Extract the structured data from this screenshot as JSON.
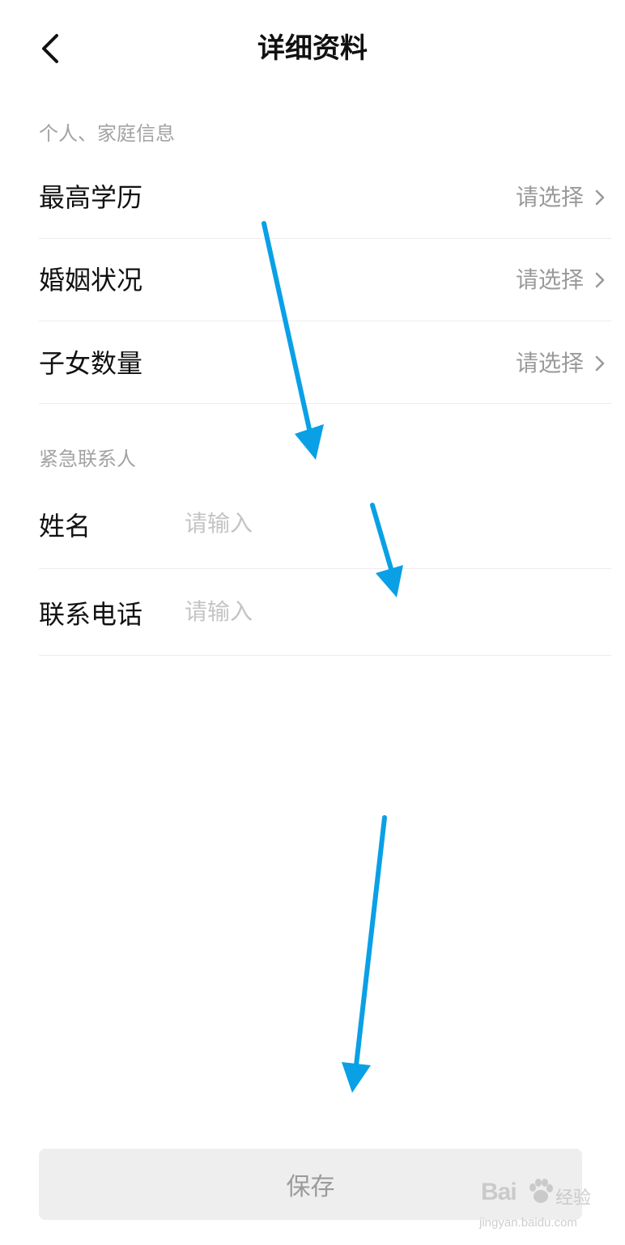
{
  "header": {
    "title": "详细资料",
    "back_icon": "chevron-left-icon"
  },
  "sections": [
    {
      "title": "个人、家庭信息",
      "rows": [
        {
          "label": "最高学历",
          "value": "请选择"
        },
        {
          "label": "婚姻状况",
          "value": "请选择"
        },
        {
          "label": "子女数量",
          "value": "请选择"
        }
      ]
    },
    {
      "title": "紧急联系人",
      "fields": [
        {
          "label": "姓名",
          "value": "",
          "placeholder": "请输入"
        },
        {
          "label": "联系电话",
          "value": "",
          "placeholder": "请输入"
        }
      ]
    }
  ],
  "footer": {
    "save_label": "保存"
  },
  "colors": {
    "annotation_arrow": "#0aa0e6",
    "muted_text": "#9a9a9a",
    "button_bg": "#eeeeee"
  },
  "watermark": {
    "brand": "Bai",
    "brand2": "经验",
    "url": "jingyan.baidu.com"
  }
}
